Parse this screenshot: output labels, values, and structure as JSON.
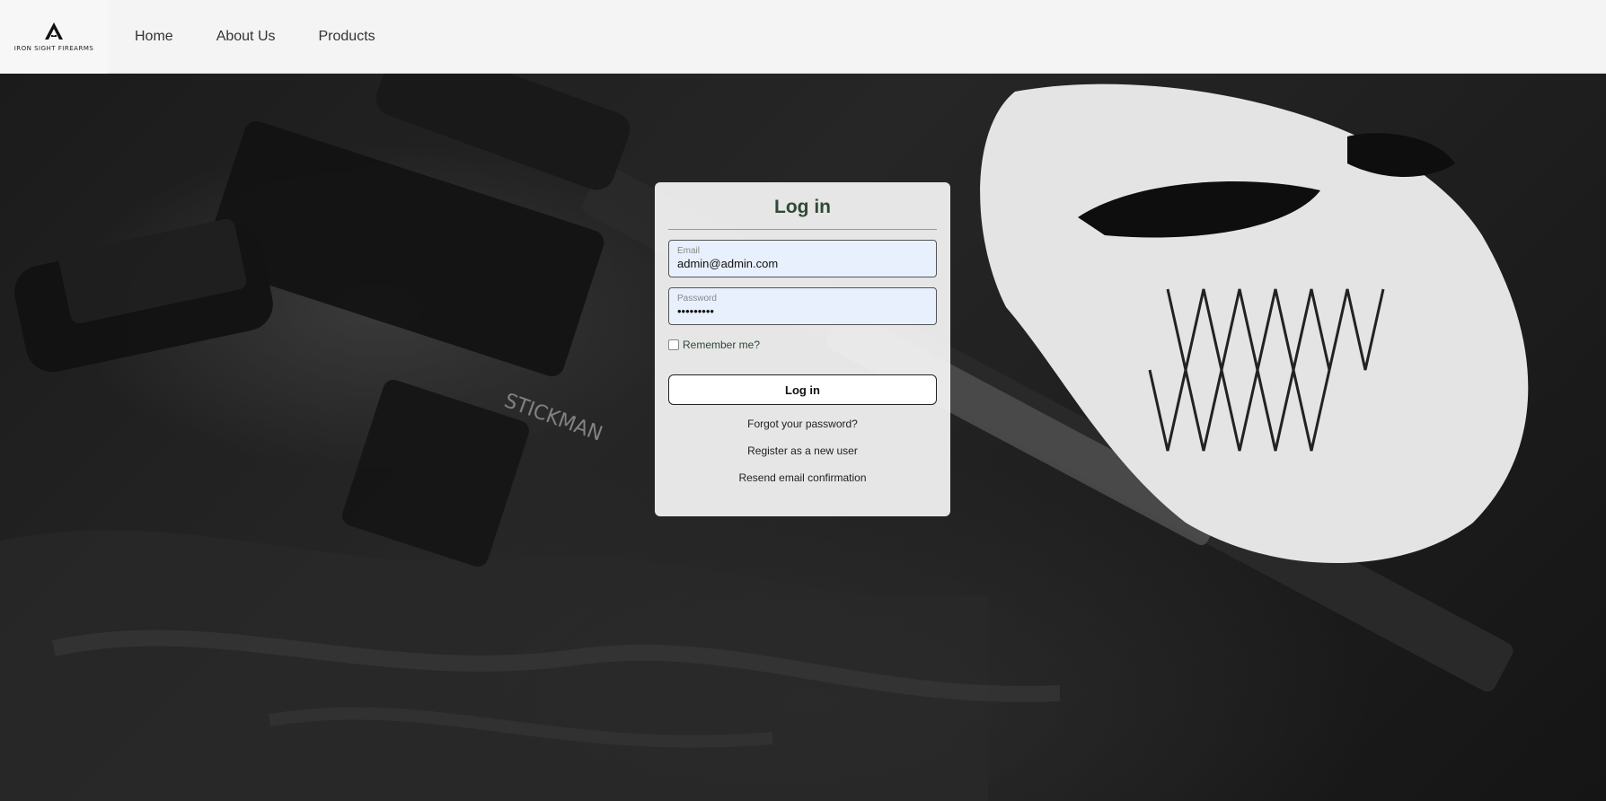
{
  "brand": {
    "logo_icon": "crosshair-a-logo",
    "name": "IRON SIGHT FIREARMS"
  },
  "nav": {
    "items": [
      {
        "label": "Home"
      },
      {
        "label": "About Us"
      },
      {
        "label": "Products"
      }
    ]
  },
  "login": {
    "title": "Log in",
    "email": {
      "label": "Email",
      "value": "admin@admin.com"
    },
    "password": {
      "label": "Password",
      "value": "•••••••••"
    },
    "remember_label": "Remember me?",
    "remember_checked": false,
    "submit_label": "Log in",
    "links": [
      {
        "label": "Forgot your password?"
      },
      {
        "label": "Register as a new user"
      },
      {
        "label": "Resend email confirmation"
      }
    ]
  },
  "colors": {
    "title_green": "#2f4a35",
    "navbar_bg": "#f4f4f4",
    "input_bg": "#e8f0fe"
  }
}
